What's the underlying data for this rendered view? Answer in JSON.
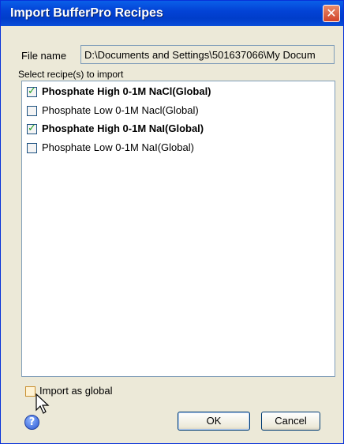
{
  "window": {
    "title": "Import BufferPro Recipes",
    "close_icon": "close-icon"
  },
  "file": {
    "label": "File name",
    "path": "D:\\Documents and Settings\\501637066\\My Docum"
  },
  "recipes": {
    "section_label": "Select recipe(s) to import",
    "items": [
      {
        "label": "Phosphate High 0-1M NaCl(Global)",
        "checked": true
      },
      {
        "label": "Phosphate Low 0-1M Nacl(Global)",
        "checked": false
      },
      {
        "label": "Phosphate High 0-1M NaI(Global)",
        "checked": true
      },
      {
        "label": "Phosphate Low 0-1M NaI(Global)",
        "checked": false
      }
    ]
  },
  "import_global": {
    "label": "Import as global",
    "checked": false
  },
  "footer": {
    "help_icon": "help-icon",
    "ok_label": "OK",
    "cancel_label": "Cancel"
  },
  "colors": {
    "titlebar": "#0343d6",
    "close_button": "#d2442a",
    "dialog_background": "#ece9d8",
    "checkmark": "#21a121"
  }
}
